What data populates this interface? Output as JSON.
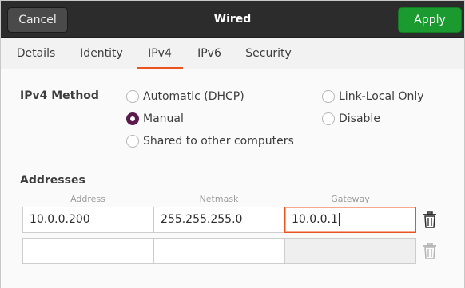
{
  "header": {
    "title": "Wired",
    "cancel_label": "Cancel",
    "apply_label": "Apply"
  },
  "tabs": [
    {
      "label": "Details",
      "active": false
    },
    {
      "label": "Identity",
      "active": false
    },
    {
      "label": "IPv4",
      "active": true
    },
    {
      "label": "IPv6",
      "active": false
    },
    {
      "label": "Security",
      "active": false
    }
  ],
  "ipv4_method": {
    "label": "IPv4 Method",
    "options": [
      {
        "label": "Automatic (DHCP)",
        "checked": false
      },
      {
        "label": "Manual",
        "checked": true
      },
      {
        "label": "Shared to other computers",
        "checked": false
      },
      {
        "label": "Link-Local Only",
        "checked": false
      },
      {
        "label": "Disable",
        "checked": false
      }
    ]
  },
  "addresses": {
    "label": "Addresses",
    "columns": [
      "Address",
      "Netmask",
      "Gateway"
    ],
    "rows": [
      {
        "address": "10.0.0.200",
        "netmask": "255.255.255.0",
        "gateway": "10.0.0.1"
      },
      {
        "address": "",
        "netmask": "",
        "gateway": ""
      }
    ]
  },
  "colors": {
    "accent": "#e95420",
    "apply": "#1a9a2f",
    "radio_checked": "#5a1a4c",
    "headerbar": "#2c2c2c"
  }
}
